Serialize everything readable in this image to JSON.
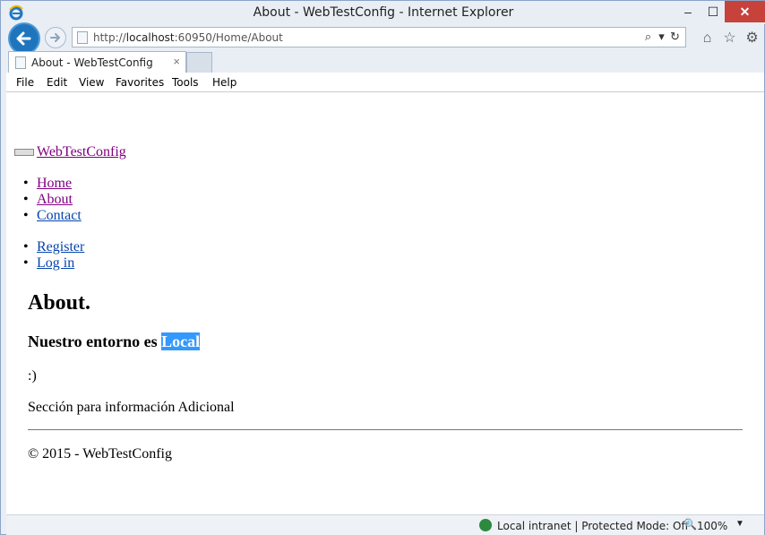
{
  "window": {
    "title": "About - WebTestConfig - Internet Explorer",
    "minimize": "–",
    "maximize": "☐",
    "close": "✕"
  },
  "address": {
    "url_prefix": "http://",
    "url_host": "localhost",
    "url_rest": ":60950/Home/About",
    "search_icon": "⌕",
    "dropdown_icon": "▾",
    "refresh_icon": "↻"
  },
  "toolbar": {
    "home_icon": "⌂",
    "favorites_icon": "☆",
    "settings_icon": "⚙"
  },
  "tab": {
    "label": "About - WebTestConfig",
    "close": "×"
  },
  "menu": [
    "File",
    "Edit",
    "View",
    "Favorites",
    "Tools",
    "Help"
  ],
  "page": {
    "brand": "WebTestConfig",
    "nav": [
      "Home",
      "About",
      "Contact"
    ],
    "account": [
      "Register",
      "Log in"
    ],
    "heading": "About.",
    "env_prefix": "Nuestro entorno es ",
    "env_value": "Local",
    "smiley": ":)",
    "section_text": "Sección para información Adicional",
    "footer": "© 2015 - WebTestConfig"
  },
  "status": {
    "zone": "Local intranet | Protected Mode: Off",
    "zoom": "100%",
    "zoom_dropdown": "▼"
  }
}
